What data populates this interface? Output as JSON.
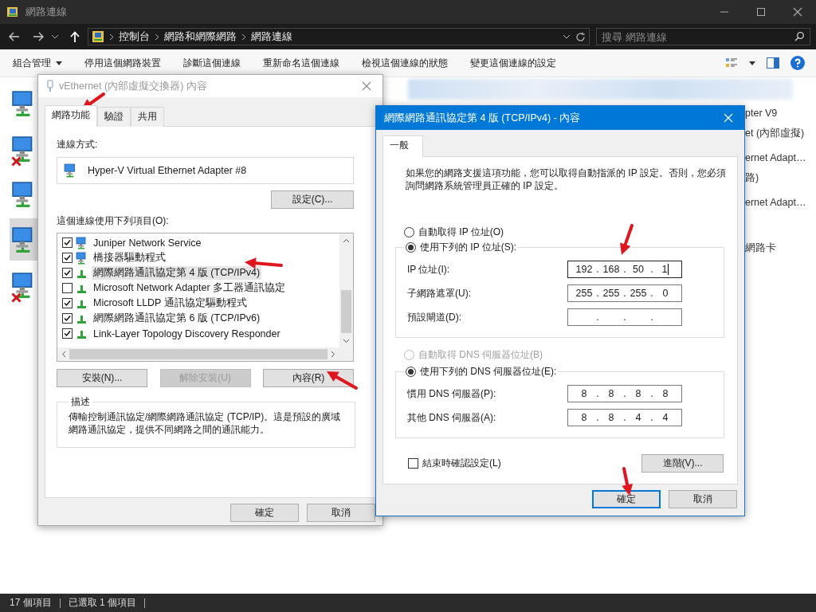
{
  "explorer": {
    "title": "網路連線",
    "breadcrumb": [
      "控制台",
      "網路和網際網路",
      "網路連線"
    ],
    "search": {
      "placeholder": "搜尋 網路連線"
    },
    "commands": [
      {
        "label": "組合管理",
        "menu": true
      },
      {
        "label": "停用這個網路裝置",
        "menu": false
      },
      {
        "label": "診斷這個連線",
        "menu": false
      },
      {
        "label": "重新命名這個連線",
        "menu": false
      },
      {
        "label": "檢視這個連線的狀態",
        "menu": false
      },
      {
        "label": "變更這個連線的設定",
        "menu": false
      }
    ],
    "connections": [
      {
        "disconnected": false,
        "selected": false
      },
      {
        "disconnected": true,
        "selected": false
      },
      {
        "disconnected": false,
        "selected": false
      },
      {
        "disconnected": false,
        "selected": true
      },
      {
        "disconnected": true,
        "selected": false
      }
    ],
    "tile_fragments": [
      [
        "pter V9",
        "et (內部虛擬)"
      ],
      [
        "ernet Adapt…",
        "路)"
      ],
      [
        "ernet Adapt…"
      ],
      [
        "網路卡"
      ]
    ],
    "status_bar": [
      "17 個項目",
      "已選取 1 個項目"
    ]
  },
  "adapter_dialog": {
    "title": "vEthernet (內部虛擬交換器) 內容",
    "active": false,
    "tabs": [
      {
        "label": "網路功能",
        "selected": true
      },
      {
        "label": "驗證",
        "selected": false
      },
      {
        "label": "共用",
        "selected": false
      }
    ],
    "connect_using_label": "連線方式:",
    "adapter": "Hyper-V Virtual Ethernet Adapter #8",
    "configure_button": "設定(C)...",
    "items_label": "這個連線使用下列項目(O):",
    "items": [
      {
        "kind": "client",
        "label": "Juniper Network Service",
        "checked": true,
        "selected": false
      },
      {
        "kind": "client",
        "label": "橋接器驅動程式",
        "checked": true,
        "selected": false
      },
      {
        "kind": "protocol",
        "label": "網際網路通訊協定第 4 版 (TCP/IPv4)",
        "checked": true,
        "selected": true
      },
      {
        "kind": "protocol",
        "label": "Microsoft Network Adapter 多工器通訊協定",
        "checked": false,
        "selected": false
      },
      {
        "kind": "protocol",
        "label": "Microsoft LLDP 通訊協定驅動程式",
        "checked": true,
        "selected": false
      },
      {
        "kind": "protocol",
        "label": "網際網路通訊協定第 6 版 (TCP/IPv6)",
        "checked": true,
        "selected": false
      },
      {
        "kind": "protocol",
        "label": "Link-Layer Topology Discovery Responder",
        "checked": true,
        "selected": false
      }
    ],
    "item_buttons": [
      {
        "label": "安裝(N)...",
        "disabled": false
      },
      {
        "label": "解除安裝(U)",
        "disabled": true
      },
      {
        "label": "內容(R)",
        "disabled": false
      }
    ],
    "description": {
      "title": "描述",
      "text": "傳輸控制通訊協定/網際網路通訊協定 (TCP/IP)。這是預設的廣域網路通訊協定，提供不同網路之間的通訊能力。"
    },
    "buttons": [
      "確定",
      "取消"
    ]
  },
  "ipv4_dialog": {
    "title": "網際網路通訊協定第 4 版 (TCP/IPv4) - 內容",
    "active": true,
    "tabs": [
      {
        "label": "一般",
        "selected": true
      }
    ],
    "intro": "如果您的網路支援這項功能，您可以取得自動指派的 IP 設定。否則，您必須詢問網路系統管理員正確的 IP 設定。",
    "ip_separator": ".",
    "ip_mode": [
      {
        "label": "自動取得 IP 位址(O)",
        "selected": false,
        "disabled": false
      },
      {
        "label": "使用下列的 IP 位址(S):",
        "selected": true,
        "disabled": false
      }
    ],
    "ip_fields": [
      {
        "label": "IP 位址(I):",
        "octets": [
          "192",
          "168",
          "50",
          "1"
        ],
        "focused": true
      },
      {
        "label": "子網路遮罩(U):",
        "octets": [
          "255",
          "255",
          "255",
          "0"
        ],
        "focused": false
      },
      {
        "label": "預設閘道(D):",
        "focused": false
      }
    ],
    "dns_mode": [
      {
        "label": "自動取得 DNS 伺服器位址(B)",
        "selected": false,
        "disabled": true
      },
      {
        "label": "使用下列的 DNS 伺服器位址(E):",
        "selected": true,
        "disabled": false
      }
    ],
    "dns_fields": [
      {
        "label": "慣用 DNS 伺服器(P):",
        "octets": [
          "8",
          "8",
          "8",
          "8"
        ],
        "focused": false
      },
      {
        "label": "其他 DNS 伺服器(A):",
        "octets": [
          "8",
          "8",
          "4",
          "4"
        ],
        "focused": false
      }
    ],
    "validate": {
      "label": "結束時確認設定(L)",
      "checked": false
    },
    "advanced_button": "進階(V)...",
    "buttons": [
      {
        "label": "確定",
        "default": true
      },
      {
        "label": "取消",
        "default": false
      }
    ]
  }
}
